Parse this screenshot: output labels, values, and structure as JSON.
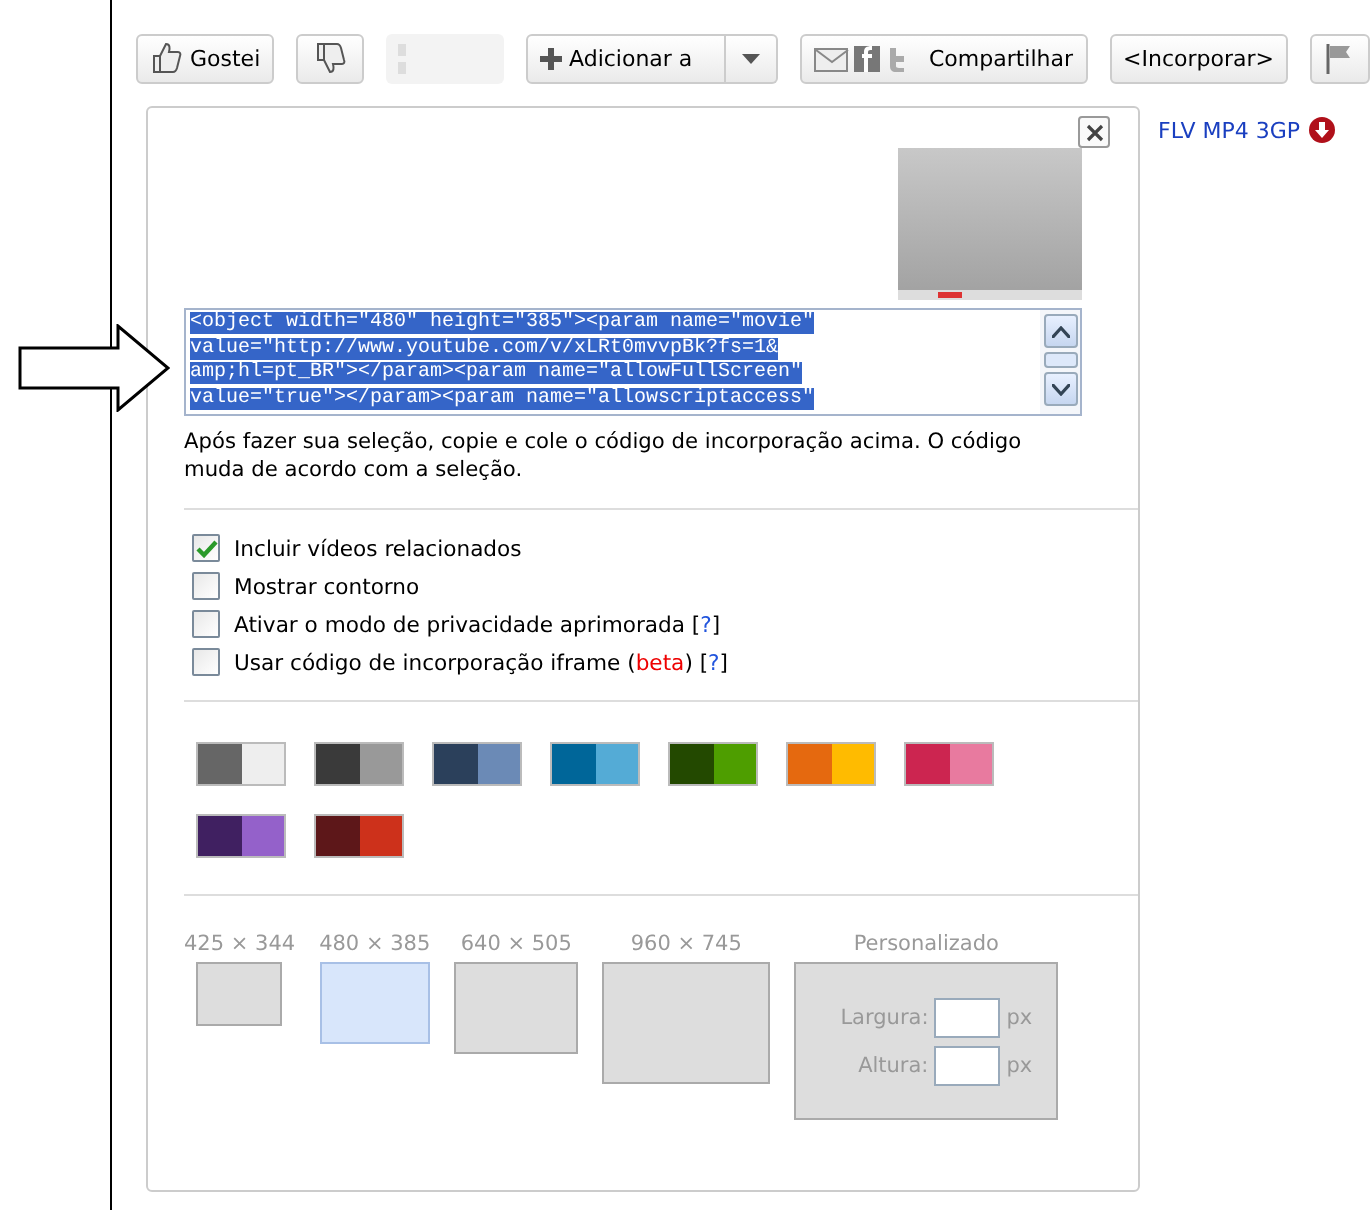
{
  "toolbar": {
    "buttons": [
      {
        "kind": "like",
        "label": "Gostei"
      },
      {
        "kind": "dislike"
      },
      {
        "kind": "placeholder"
      },
      {
        "kind": "add",
        "label": "Adicionar a"
      },
      {
        "kind": "share",
        "label": "Compartilhar"
      },
      {
        "kind": "embed",
        "label": "<Incorporar>"
      },
      {
        "kind": "flag"
      }
    ]
  },
  "download": {
    "label": "FLV MP4 3GP"
  },
  "embed_panel": {
    "code_lines": [
      "<object width=\"480\" height=\"385\"><param name=\"movie\"",
      "value=\"http://www.youtube.com/v/xLRt0mvvpBk?fs=1&",
      "amp;hl=pt_BR\"></param><param name=\"allowFullScreen\"",
      "value=\"true\"></param><param name=\"allowscriptaccess\""
    ],
    "hint": "Após fazer sua seleção, copie e cole o código de incorporação acima. O código muda de acordo com a seleção.",
    "options": [
      {
        "label": "Incluir vídeos relacionados",
        "checked": true
      },
      {
        "label": "Mostrar contorno",
        "checked": false
      },
      {
        "label": "Ativar o modo de privacidade aprimorada [?]",
        "checked": false
      },
      {
        "label": "Usar código de incorporação iframe (**beta**) [?]",
        "checked": false
      }
    ],
    "color_schemes": [
      {
        "halves": [
          {
            "color": "#666666"
          },
          {
            "color": "#eeeeee"
          }
        ]
      },
      {
        "halves": [
          {
            "color": "#3a3a3a"
          },
          {
            "color": "#999999"
          }
        ]
      },
      {
        "halves": [
          {
            "color": "#2b405b"
          },
          {
            "color": "#6b8ab6"
          }
        ]
      },
      {
        "halves": [
          {
            "color": "#006699"
          },
          {
            "color": "#54abd6"
          }
        ]
      },
      {
        "halves": [
          {
            "color": "#234900"
          },
          {
            "color": "#4e9e00"
          }
        ]
      },
      {
        "halves": [
          {
            "color": "#e5690f"
          },
          {
            "color": "#ffbb00"
          }
        ]
      },
      {
        "halves": [
          {
            "color": "#cc2550"
          },
          {
            "color": "#e87a9f"
          }
        ]
      },
      {
        "halves": [
          {
            "color": "#402061"
          },
          {
            "color": "#9461ca"
          }
        ]
      },
      {
        "halves": [
          {
            "color": "#5d1719"
          },
          {
            "color": "#cd311b"
          }
        ]
      }
    ],
    "sizes": [
      {
        "label": "425 × 344",
        "selected": false
      },
      {
        "label": "480 × 385",
        "selected": true
      },
      {
        "label": "640 × 505",
        "selected": false
      },
      {
        "label": "960 × 745",
        "selected": false
      }
    ],
    "custom_size": {
      "title": "Personalizado",
      "fields": [
        {
          "label": "Largura:",
          "unit": "px"
        },
        {
          "label": "Altura:",
          "unit": "px"
        }
      ]
    }
  }
}
